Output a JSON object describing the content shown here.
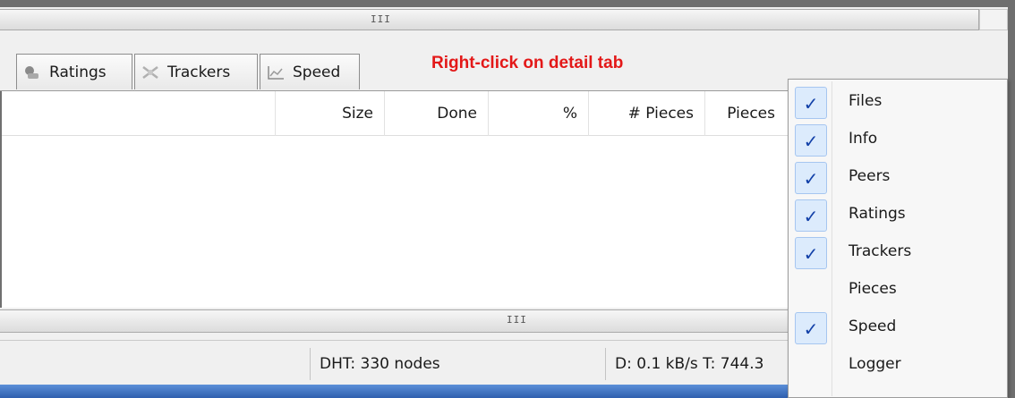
{
  "scrollbar_top": {
    "grip": "III"
  },
  "tabs": [
    {
      "label": "Ratings",
      "icon": "ratings-icon"
    },
    {
      "label": "Trackers",
      "icon": "trackers-icon"
    },
    {
      "label": "Speed",
      "icon": "speed-chart-icon"
    }
  ],
  "hint": {
    "text": "Right-click on detail tab",
    "color": "#e31818"
  },
  "table": {
    "columns": [
      "Size",
      "Done",
      "%",
      "# Pieces",
      "Pieces"
    ]
  },
  "scrollbar_bottom": {
    "grip": "III"
  },
  "status": {
    "dht": "DHT: 330 nodes",
    "rates": "D: 0.1 kB/s T: 744.3"
  },
  "context_menu": {
    "items": [
      {
        "label": "Files",
        "checked": true
      },
      {
        "label": "Info",
        "checked": true
      },
      {
        "label": "Peers",
        "checked": true
      },
      {
        "label": "Ratings",
        "checked": true
      },
      {
        "label": "Trackers",
        "checked": true
      },
      {
        "label": "Pieces",
        "checked": false
      },
      {
        "label": "Speed",
        "checked": true
      },
      {
        "label": "Logger",
        "checked": false
      }
    ],
    "check_glyph": "✓"
  }
}
